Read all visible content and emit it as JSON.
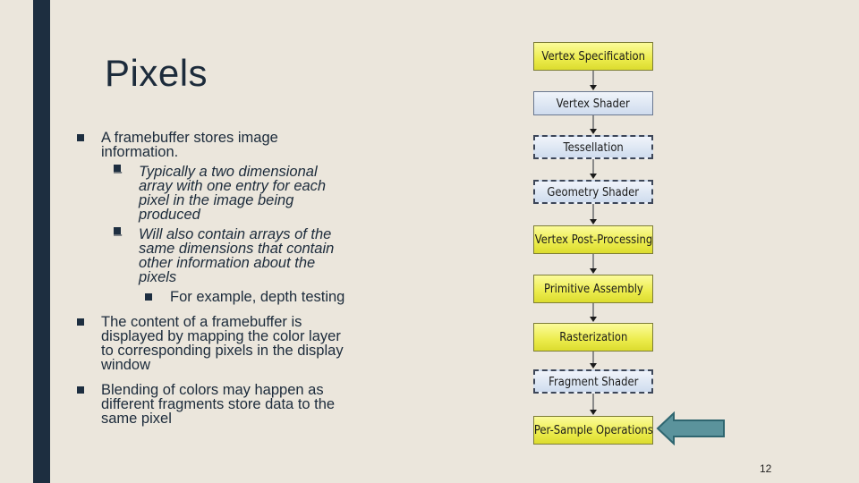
{
  "slide": {
    "title": "Pixels",
    "page_number": "12"
  },
  "bullets": [
    {
      "text": "A framebuffer stores image information.",
      "sub": [
        {
          "text": "Typically a two dimensional array with one entry for each pixel in the image being produced"
        },
        {
          "text": "Will also contain arrays of the same dimensions that contain other information about the pixels",
          "sub": [
            {
              "text": "For example, depth testing"
            }
          ]
        }
      ]
    },
    {
      "text": "The content of a framebuffer is displayed by mapping the color layer to corresponding pixels in the display window"
    },
    {
      "text": "Blending of colors may happen as different fragments store data to the same pixel"
    }
  ],
  "sub_marker": "–",
  "pipeline": {
    "stages": [
      {
        "label": "Vertex Specification",
        "kind": "fixed"
      },
      {
        "label": "Vertex Shader",
        "kind": "programmable"
      },
      {
        "label": "Tessellation",
        "kind": "optional"
      },
      {
        "label": "Geometry Shader",
        "kind": "optional"
      },
      {
        "label": "Vertex Post-Processing",
        "kind": "fixed"
      },
      {
        "label": "Primitive Assembly",
        "kind": "fixed"
      },
      {
        "label": "Rasterization",
        "kind": "fixed"
      },
      {
        "label": "Fragment Shader",
        "kind": "optional"
      },
      {
        "label": "Per-Sample Operations",
        "kind": "fixed"
      }
    ],
    "highlighted_stage": "Per-Sample Operations",
    "highlight_arrow_color": "#5b939c"
  }
}
